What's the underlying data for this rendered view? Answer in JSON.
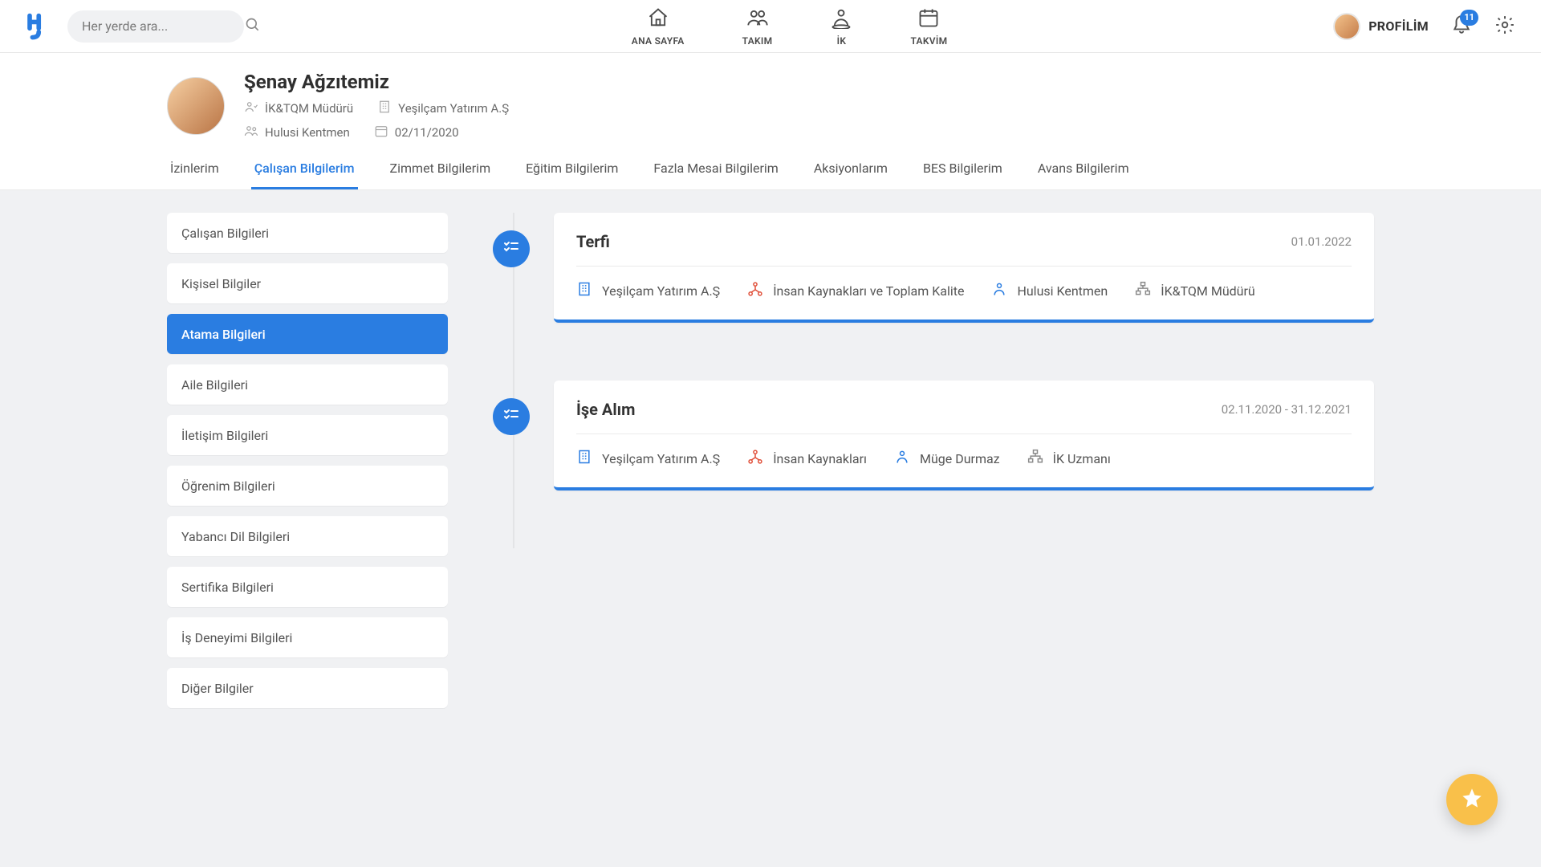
{
  "topbar": {
    "search_placeholder": "Her yerde ara...",
    "nav": [
      {
        "label": "ANA SAYFA",
        "icon": "home-icon"
      },
      {
        "label": "TAKIM",
        "icon": "team-icon"
      },
      {
        "label": "İK",
        "icon": "hr-icon"
      },
      {
        "label": "TAKVİM",
        "icon": "calendar-icon"
      }
    ],
    "profile_label": "PROFİLİM",
    "notification_count": "11"
  },
  "person": {
    "name": "Şenay Ağzıtemiz",
    "title": "İK&TQM Müdürü",
    "company": "Yeşilçam Yatırım A.Ş",
    "manager": "Hulusi Kentmen",
    "date": "02/11/2020"
  },
  "tabs": [
    "İzinlerim",
    "Çalışan Bilgilerim",
    "Zimmet Bilgilerim",
    "Eğitim Bilgilerim",
    "Fazla Mesai Bilgilerim",
    "Aksiyonlarım",
    "BES Bilgilerim",
    "Avans Bilgilerim"
  ],
  "tab_active_index": 1,
  "sidenav": [
    "Çalışan Bilgileri",
    "Kişisel Bilgiler",
    "Atama Bilgileri",
    "Aile Bilgileri",
    "İletişim Bilgileri",
    "Öğrenim Bilgileri",
    "Yabancı Dil Bilgileri",
    "Sertifika Bilgileri",
    "İş Deneyimi Bilgileri",
    "Diğer Bilgiler"
  ],
  "sidenav_active_index": 2,
  "timeline": [
    {
      "title": "Terfi",
      "date": "01.01.2022",
      "company": "Yeşilçam Yatırım A.Ş",
      "department": "İnsan Kaynakları ve Toplam Kalite",
      "manager": "Hulusi Kentmen",
      "position": "İK&TQM Müdürü"
    },
    {
      "title": "İşe Alım",
      "date": "02.11.2020 - 31.12.2021",
      "company": "Yeşilçam Yatırım A.Ş",
      "department": "İnsan Kaynakları",
      "manager": "Müge Durmaz",
      "position": "İK Uzmanı"
    }
  ]
}
